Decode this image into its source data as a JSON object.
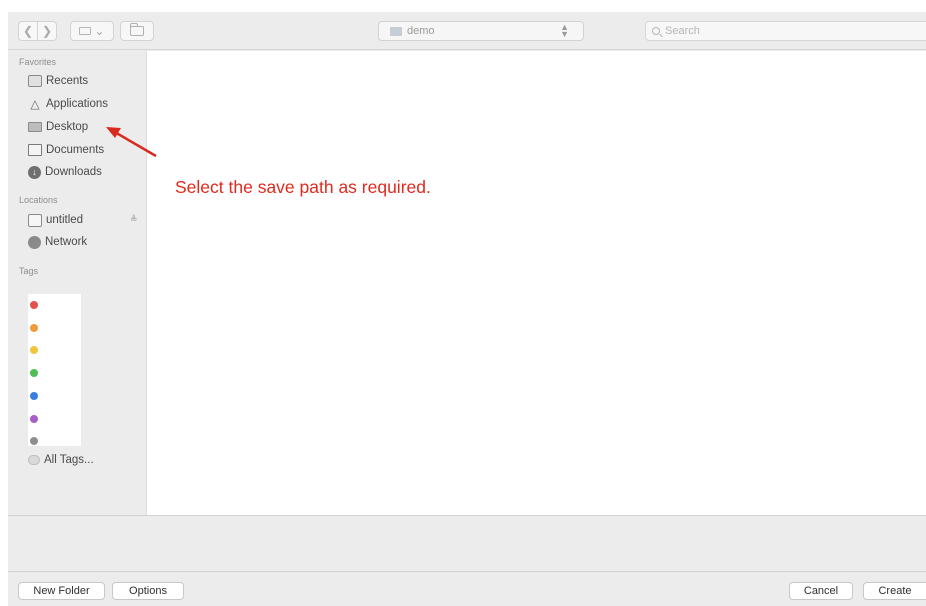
{
  "toolbar": {
    "back_icon": "chevron-left-icon",
    "forward_icon": "chevron-right-icon",
    "view_icon": "grid-view-icon",
    "view_chevron": "⌄",
    "new_folder_icon": "folder-icon",
    "location": "demo",
    "search_placeholder": "Search"
  },
  "sidebar": {
    "favorites_title": "Favorites",
    "favorites": [
      {
        "label": "Recents",
        "icon": "recents-icon"
      },
      {
        "label": "Applications",
        "icon": "applications-icon"
      },
      {
        "label": "Desktop",
        "icon": "desktop-icon"
      },
      {
        "label": "Documents",
        "icon": "documents-icon"
      },
      {
        "label": "Downloads",
        "icon": "downloads-icon"
      }
    ],
    "locations_title": "Locations",
    "locations": [
      {
        "label": "untitled",
        "icon": "disk-icon"
      },
      {
        "label": "Network",
        "icon": "network-icon"
      }
    ],
    "eject_symbol": "≜",
    "tags_title": "Tags",
    "tag_colors": [
      "#e4514a",
      "#f09a3a",
      "#f2c53d",
      "#4cbf55",
      "#3a7ee0",
      "#a55ec9",
      "#8e8e8e"
    ],
    "all_tags": "All Tags..."
  },
  "annotation": {
    "text": "Select the save path as required.",
    "color": "#e02a1e"
  },
  "buttons": {
    "new_folder": "New Folder",
    "options": "Options",
    "cancel": "Cancel",
    "create": "Create"
  }
}
